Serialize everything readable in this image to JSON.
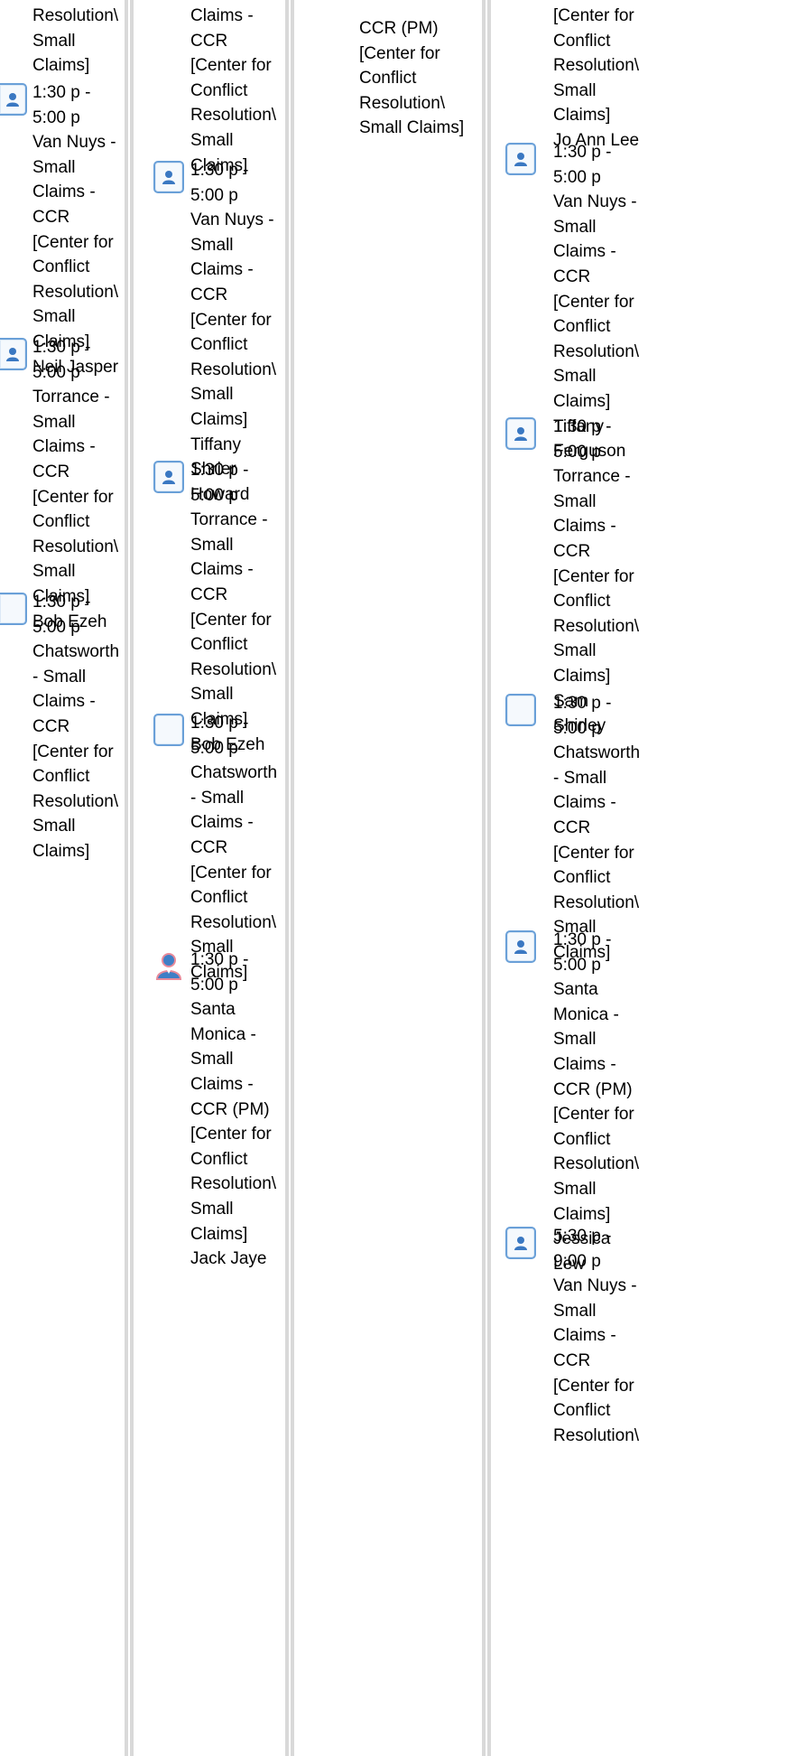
{
  "entries": [
    {
      "text": "Resolution\\\nSmall\nClaims]"
    },
    {
      "text": "1:30 p -\n5:00 p\nVan Nuys -\nSmall\nClaims -\nCCR\n[Center for\nConflict\nResolution\\\nSmall\nClaims]\nNeil Jasper"
    },
    {
      "text": "1:30 p -\n5:00 p\nTorrance -\nSmall\nClaims -\nCCR\n[Center for\nConflict\nResolution\\\nSmall\nClaims]\nBob Ezeh"
    },
    {
      "text": "1:30 p -\n5:00 p\nChatsworth\n- Small\nClaims -\nCCR\n[Center for\nConflict\nResolution\\\nSmall\nClaims]"
    },
    {
      "text": "Claims -\nCCR\n[Center for\nConflict\nResolution\\\nSmall\nClaims]"
    },
    {
      "text": "1:30 p -\n5:00 p\nVan Nuys -\nSmall\nClaims -\nCCR\n[Center for\nConflict\nResolution\\\nSmall\nClaims]\nTiffany\nShrier\nHoward"
    },
    {
      "text": "1:30 p -\n5:00 p\nTorrance -\nSmall\nClaims -\nCCR\n[Center for\nConflict\nResolution\\\nSmall\nClaims]\nBob Ezeh"
    },
    {
      "text": "1:30 p -\n5:00 p\nChatsworth\n- Small\nClaims -\nCCR\n[Center for\nConflict\nResolution\\\nSmall\nClaims]"
    },
    {
      "text": "1:30 p -\n5:00 p\nSanta\nMonica -\nSmall\nClaims -\nCCR (PM)\n[Center for\nConflict\nResolution\\\nSmall\nClaims]\nJack Jaye"
    },
    {
      "text": "CCR (PM)\n[Center for\nConflict\nResolution\\\nSmall Claims]"
    },
    {
      "text": "[Center for\nConflict\nResolution\\\nSmall\nClaims]\nJo Ann Lee"
    },
    {
      "text": "1:30 p -\n5:00 p\nVan Nuys -\nSmall\nClaims -\nCCR\n[Center for\nConflict\nResolution\\\nSmall\nClaims]\nTiffany\nFerguson"
    },
    {
      "text": "1:30 p -\n5:00 p\nTorrance -\nSmall\nClaims -\nCCR\n[Center for\nConflict\nResolution\\\nSmall\nClaims]\nSam\nShirley"
    },
    {
      "text": "1:30 p -\n5:00 p\nChatsworth\n- Small\nClaims -\nCCR\n[Center for\nConflict\nResolution\\\nSmall\nClaims]"
    },
    {
      "text": "1:30 p -\n5:00 p\nSanta\nMonica -\nSmall\nClaims -\nCCR (PM)\n[Center for\nConflict\nResolution\\\nSmall\nClaims]\nJessica\nLew"
    },
    {
      "text": "5:30 p -\n9:00 p\nVan Nuys -\nSmall\nClaims -\nCCR\n[Center for\nConflict\nResolution\\"
    }
  ],
  "icons": {
    "assigned": "user-icon",
    "unassigned": "empty-slot-icon",
    "person": "person-icon"
  },
  "colors": {
    "icon_border": "#6aa0d8",
    "user_head": "#3a78c2",
    "person_body": "#3f7fc6",
    "person_outline": "#e88a9a",
    "separator": "#d9d9d9"
  }
}
